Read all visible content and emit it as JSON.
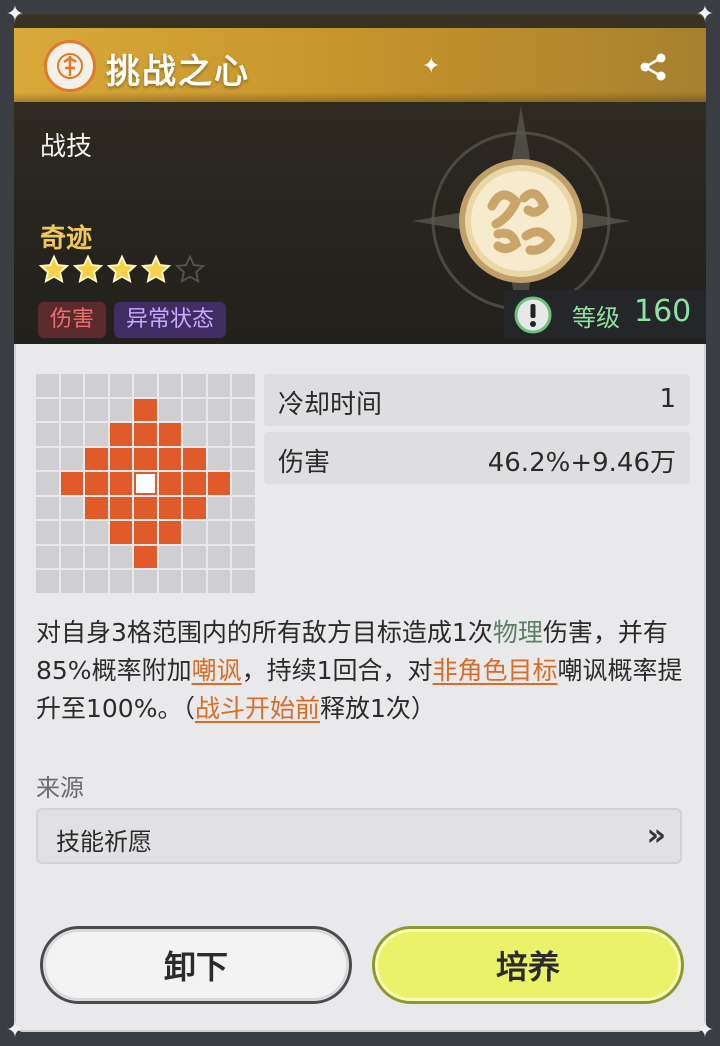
{
  "header": {
    "title": "挑战之心",
    "category": "战技",
    "rarity": "奇迹",
    "stars_filled": 4,
    "stars_total": 5,
    "tags": [
      "伤害",
      "异常状态"
    ],
    "level_label": "等级",
    "level_value": "160"
  },
  "stats": [
    {
      "key": "冷却时间",
      "value": "1"
    },
    {
      "key": "伤害",
      "value": "46.2%+9.46万"
    }
  ],
  "description": {
    "p1": "对自身3格范围内的所有敌方目标造成1次",
    "h1": "物理",
    "p2": "伤害，并有85%概率附加",
    "h2": "嘲讽",
    "p3": "，持续1回合，对",
    "h3": "非角色目标",
    "p4": "嘲讽概率提升至100%。（",
    "h4": "战斗开始前",
    "p5": "释放1次）"
  },
  "source": {
    "label": "来源",
    "value": "技能祈愿",
    "arrow": "»"
  },
  "buttons": {
    "unload": "卸下",
    "train": "培养"
  },
  "colors": {
    "accent_gold": "#d9a93a",
    "level_green": "#8ee29f",
    "range_orange": "#e05a2a",
    "train_button": "#eaf26a"
  }
}
